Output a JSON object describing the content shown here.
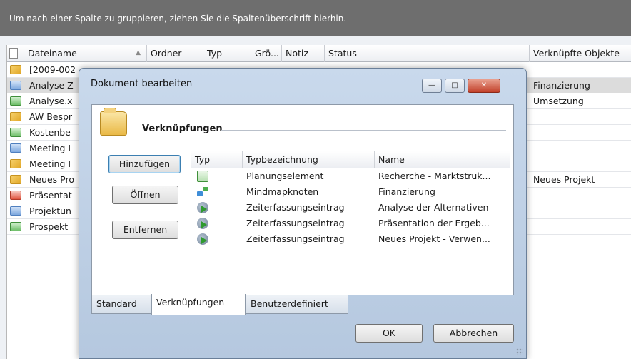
{
  "group_hint": "Um nach einer Spalte zu gruppieren, ziehen Sie die Spaltenüberschrift hierhin.",
  "grid": {
    "columns": [
      "Dateiname",
      "Ordner",
      "Typ",
      "Grö...",
      "Notiz",
      "Status",
      "Verknüpfte Objekte"
    ],
    "sort_indicator": "▲",
    "rows": [
      {
        "icon": "mail-icon",
        "name": "[2009-002",
        "linked": ""
      },
      {
        "icon": "document-icon",
        "name": "Analyse Z",
        "linked": "Finanzierung",
        "selected": true
      },
      {
        "icon": "spreadsheet-icon",
        "name": "Analyse.x",
        "linked": "Umsetzung"
      },
      {
        "icon": "mail-icon",
        "name": "AW Bespr",
        "linked": ""
      },
      {
        "icon": "spreadsheet-icon",
        "name": "Kostenbe",
        "linked": ""
      },
      {
        "icon": "document-icon",
        "name": "Meeting I",
        "linked": ""
      },
      {
        "icon": "mail-icon",
        "name": "Meeting I",
        "linked": ""
      },
      {
        "icon": "mail-icon",
        "name": "Neues Pro",
        "linked": "Neues Projekt"
      },
      {
        "icon": "presentation-icon",
        "name": "Präsentat",
        "linked": ""
      },
      {
        "icon": "document-icon",
        "name": "Projektun",
        "linked": ""
      },
      {
        "icon": "spreadsheet-icon",
        "name": "Prospekt",
        "linked": ""
      }
    ]
  },
  "dialog": {
    "title": "Dokument bearbeiten",
    "window_buttons": {
      "minimize": "—",
      "maximize": "□",
      "close": "✕"
    },
    "group_title": "Verknüpfungen",
    "buttons": {
      "add": "Hinzufügen",
      "open": "Öffnen",
      "remove": "Entfernen",
      "ok": "OK",
      "cancel": "Abbrechen"
    },
    "list": {
      "headers": [
        "Typ",
        "Typbezeichnung",
        "Name"
      ],
      "rows": [
        {
          "icon": "planning-element-icon",
          "type_name": "Planungselement",
          "name": "Recherche - Marktstruk..."
        },
        {
          "icon": "mindmap-node-icon",
          "type_name": "Mindmapknoten",
          "name": "Finanzierung"
        },
        {
          "icon": "time-entry-icon",
          "type_name": "Zeiterfassungseintrag",
          "name": "Analyse der Alternativen"
        },
        {
          "icon": "time-entry-icon",
          "type_name": "Zeiterfassungseintrag",
          "name": "Präsentation der Ergeb..."
        },
        {
          "icon": "time-entry-icon",
          "type_name": "Zeiterfassungseintrag",
          "name": "Neues Projekt - Verwen..."
        }
      ]
    },
    "tabs": [
      "Standard",
      "Verknüpfungen",
      "Benutzerdefiniert"
    ],
    "active_tab": "Verknüpfungen"
  }
}
